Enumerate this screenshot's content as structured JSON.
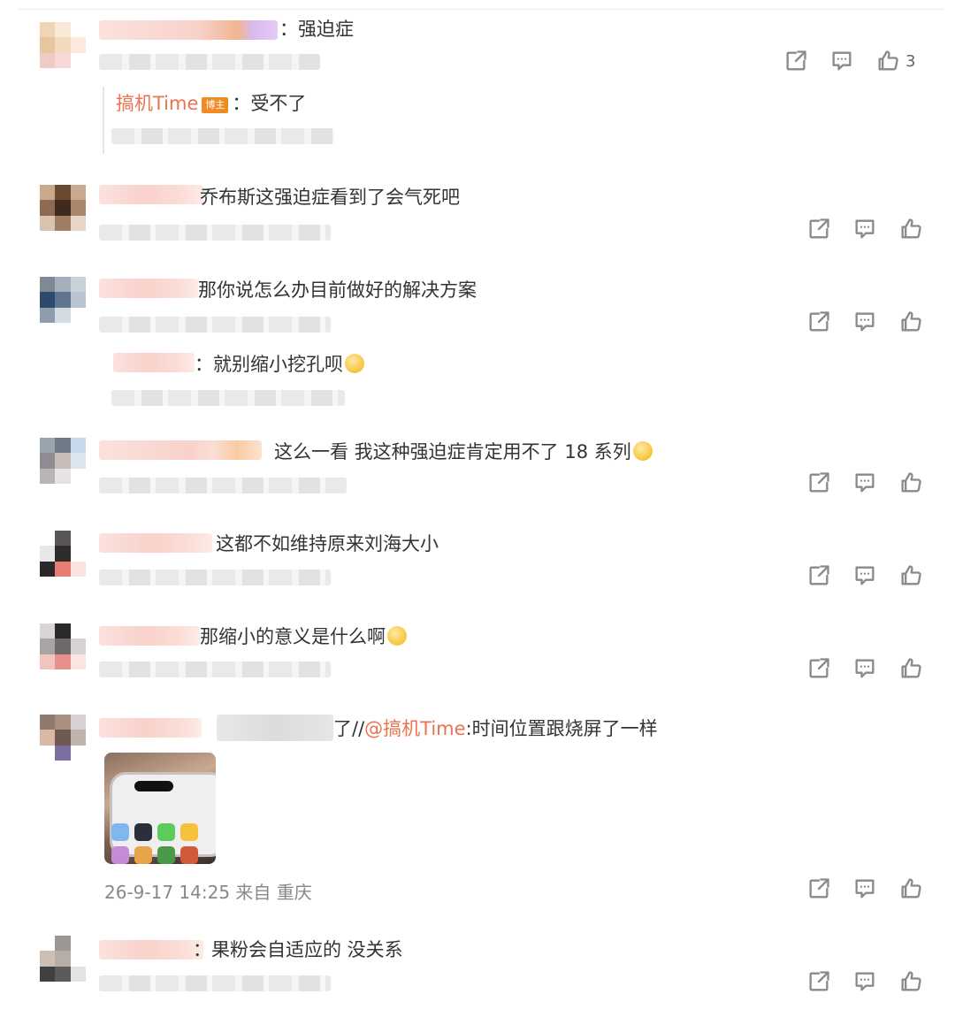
{
  "comments": [
    {
      "text": "：强迫症",
      "like_count": "3",
      "reply": {
        "author": "搞机Time",
        "badge": "博主",
        "text": "：受不了"
      }
    },
    {
      "text": "乔布斯这强迫症看到了会气死吧"
    },
    {
      "text": "那你说怎么办目前做好的解决方案",
      "reply": {
        "text": "：就别缩小挖孔呗"
      }
    },
    {
      "text": "这么一看 我这种强迫症肯定用不了 18 系列"
    },
    {
      "text": "这都不如维持原来刘海大小"
    },
    {
      "text": "那缩小的意义是什么啊"
    },
    {
      "text_before": "了//",
      "mention": "@搞机Time",
      "text_after": ":时间位置跟烧屏了一样",
      "timestamp": "26-9-17 14:25 来自 重庆"
    },
    {
      "text": "：果粉会自适应的 没关系"
    }
  ],
  "icons": {
    "share": "share-icon",
    "comment": "comment-icon",
    "like": "thumbs-up-icon",
    "emoji": "emoji-icon"
  },
  "colors": {
    "mention": "#eb7350",
    "badge": "#f08a24",
    "icon": "#8a8a8a",
    "text": "#333333",
    "meta": "#888888"
  }
}
